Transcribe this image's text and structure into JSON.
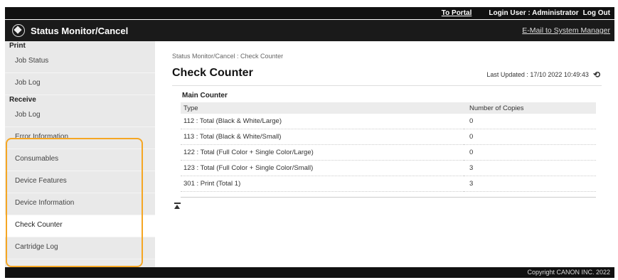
{
  "topbar": {
    "portal_link": "To Portal",
    "login_user": "Login User : Administrator",
    "logout": "Log Out"
  },
  "header": {
    "app_title": "Status Monitor/Cancel",
    "mail_link": "E-Mail to System Manager",
    "logo_icon": "canon-diamond-icon"
  },
  "sidebar": {
    "print_section": "Print",
    "print_items": [
      "Job Status",
      "Job Log"
    ],
    "receive_section": "Receive",
    "receive_items": [
      "Job Log"
    ],
    "device_items": [
      "Error Information",
      "Consumables",
      "Device Features",
      "Device Information",
      "Check Counter",
      "Cartridge Log"
    ],
    "active_item": "Check Counter",
    "highlight_color": "#f5a623"
  },
  "main": {
    "breadcrumb": "Status Monitor/Cancel : Check Counter",
    "page_title": "Check Counter",
    "last_updated": "Last Updated : 17/10 2022 10:49:43",
    "refresh_icon": "refresh-icon",
    "section_title": "Main Counter",
    "table": {
      "headers": [
        "Type",
        "Number of Copies"
      ],
      "rows": [
        [
          "112 : Total (Black & White/Large)",
          "0"
        ],
        [
          "113 : Total (Black & White/Small)",
          "0"
        ],
        [
          "122 : Total (Full Color + Single Color/Large)",
          "0"
        ],
        [
          "123 : Total (Full Color + Single Color/Small)",
          "3"
        ],
        [
          "301 : Print (Total 1)",
          "3"
        ]
      ]
    },
    "to_top_icon": "to-top-icon"
  },
  "footer": {
    "copyright": "Copyright CANON INC. 2022"
  }
}
